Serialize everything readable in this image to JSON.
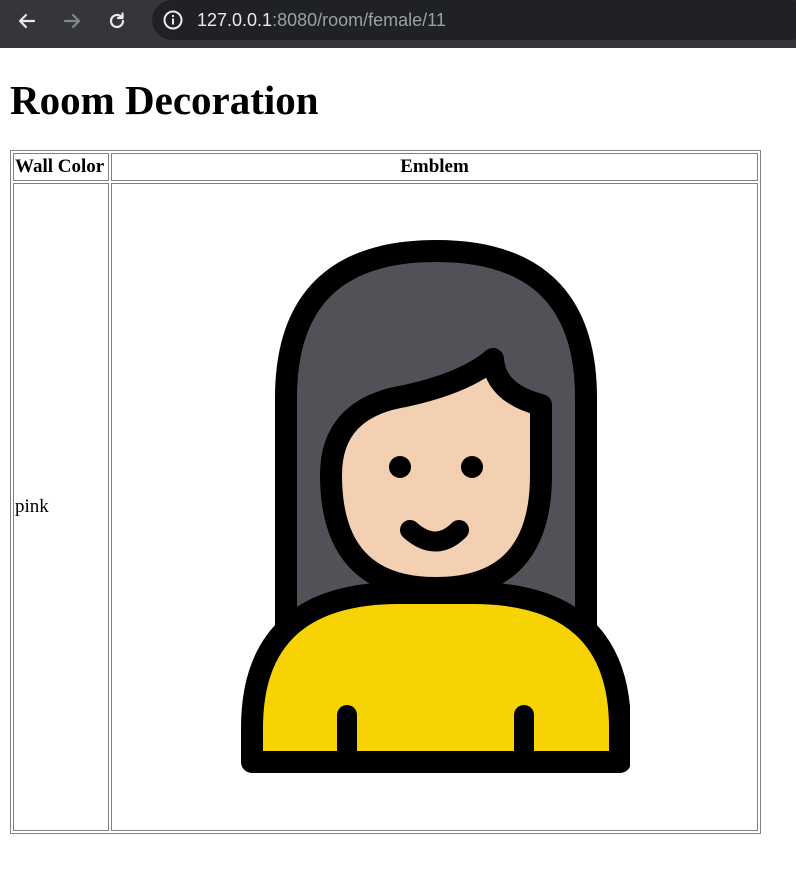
{
  "browser": {
    "url_host": "127.0.0.1",
    "url_rest": ":8080/room/female/11"
  },
  "page": {
    "title": "Room Decoration"
  },
  "table": {
    "headers": [
      "Wall Color",
      "Emblem"
    ],
    "rows": [
      {
        "wall_color": "pink",
        "emblem": "woman-avatar-icon"
      }
    ]
  },
  "colors": {
    "hair": "#545057",
    "skin": "#f2d0b1",
    "shirt": "#f7d303",
    "outline": "#000000"
  }
}
